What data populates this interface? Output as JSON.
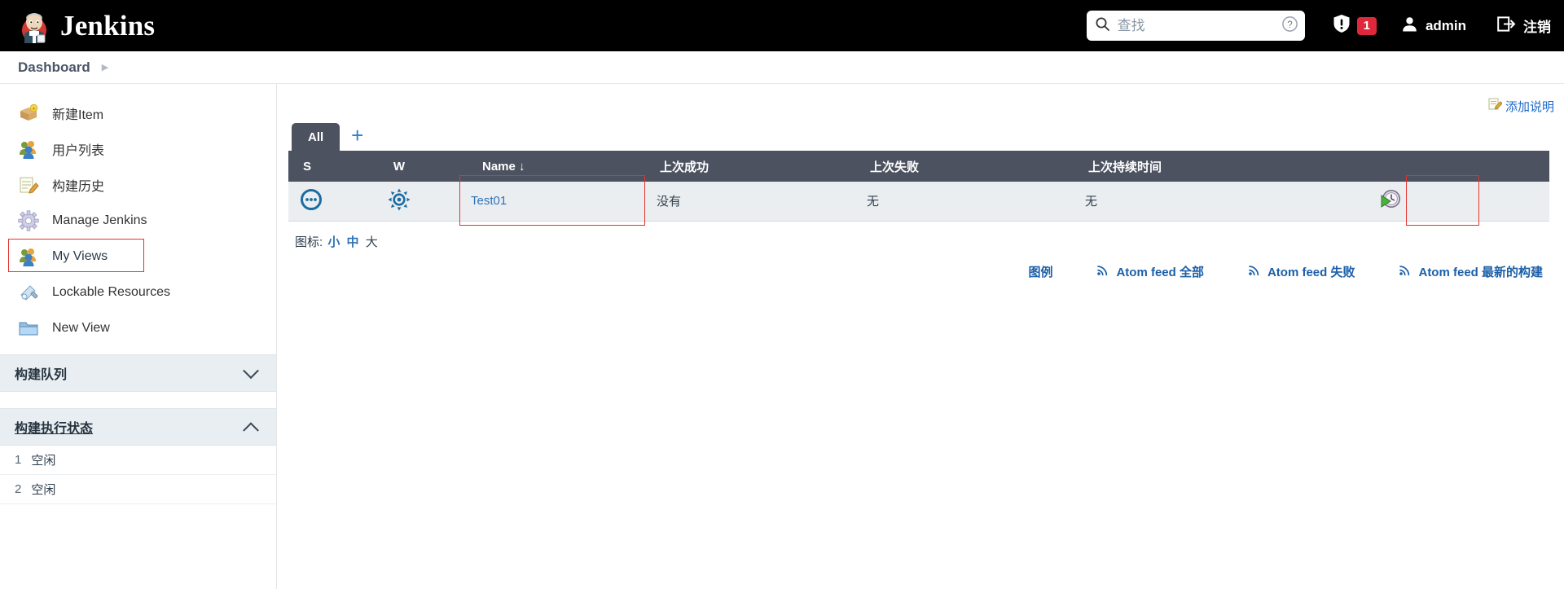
{
  "header": {
    "brand": "Jenkins",
    "brand_logo_icon": "jenkins-butler-icon",
    "search": {
      "placeholder": "查找",
      "value": "",
      "icon": "search-icon",
      "help_icon": "help-circle-icon"
    },
    "security": {
      "icon": "shield-warning-icon",
      "count": "1"
    },
    "user": {
      "icon": "person-icon",
      "name": "admin"
    },
    "logout": {
      "icon": "logout-icon",
      "label": "注销"
    }
  },
  "breadcrumb": {
    "items": [
      "Dashboard"
    ],
    "arrow_icon": "chevron-right-icon"
  },
  "sidebar": {
    "items": [
      {
        "label": "新建Item",
        "icon": "new-item-box-icon",
        "highlighted": false
      },
      {
        "label": "用户列表",
        "icon": "people-icon",
        "highlighted": false
      },
      {
        "label": "构建历史",
        "icon": "build-history-notepad-icon",
        "highlighted": false
      },
      {
        "label": "Manage Jenkins",
        "icon": "gear-icon",
        "highlighted": false
      },
      {
        "label": "My Views",
        "icon": "people-icon",
        "highlighted": true
      },
      {
        "label": "Lockable Resources",
        "icon": "usb-lock-icon",
        "highlighted": false
      },
      {
        "label": "New View",
        "icon": "folder-icon",
        "highlighted": false
      }
    ],
    "build_queue": {
      "title": "构建队列",
      "chevron": "chevron-down-icon",
      "expanded": false
    },
    "build_executor": {
      "title": "构建执行状态",
      "chevron": "chevron-up-icon",
      "expanded": true,
      "executors": [
        {
          "num": "1",
          "state": "空闲"
        },
        {
          "num": "2",
          "state": "空闲"
        }
      ]
    }
  },
  "main": {
    "add_description": {
      "label": "添加说明",
      "icon": "edit-note-icon"
    },
    "tabs": [
      {
        "label": "All",
        "active": true
      }
    ],
    "tab_add": {
      "label": "+",
      "icon": "plus-icon"
    },
    "table": {
      "columns": [
        {
          "key": "s",
          "label": "S"
        },
        {
          "key": "w",
          "label": "W"
        },
        {
          "key": "name",
          "label": "Name",
          "sort_icon": "arrow-down-icon",
          "sorted": true
        },
        {
          "key": "last_success",
          "label": "上次成功"
        },
        {
          "key": "last_failure",
          "label": "上次失败"
        },
        {
          "key": "last_duration",
          "label": "上次持续时间"
        },
        {
          "key": "actions",
          "label": ""
        }
      ],
      "rows": [
        {
          "status_icon": "not-built-dots-icon",
          "health_icon": "weather-sunny-icon",
          "name": "Test01",
          "name_boxed": true,
          "last_success": "没有",
          "last_failure": "无",
          "last_duration": "无",
          "action_icon": "schedule-build-clock-icon",
          "action_boxed": true
        }
      ]
    },
    "icon_size": {
      "label": "图标:",
      "options": [
        {
          "label": "小",
          "current": false
        },
        {
          "label": "中",
          "current": false
        },
        {
          "label": "大",
          "current": true
        }
      ]
    },
    "footer_links": [
      {
        "label": "图例",
        "icon": "legend-icon",
        "has_rss": false
      },
      {
        "label": "Atom feed 全部",
        "icon": "rss-icon",
        "has_rss": true
      },
      {
        "label": "Atom feed 失败",
        "icon": "rss-icon",
        "has_rss": true
      },
      {
        "label": "Atom feed 最新的构建",
        "icon": "rss-icon",
        "has_rss": true
      }
    ]
  },
  "colors": {
    "header_bg": "#000000",
    "table_header_bg": "#4c5260",
    "row_bg": "#eaeef0",
    "link_blue": "#2f72b8",
    "annotation_red": "#e5322d",
    "badge_red": "#e0283c",
    "panel_bg": "#e8eef2"
  }
}
